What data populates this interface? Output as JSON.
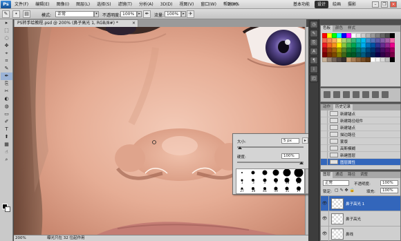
{
  "app": {
    "logo": "Ps"
  },
  "menu": [
    "文件(F)",
    "编辑(E)",
    "图像(I)",
    "图层(L)",
    "选择(S)",
    "滤镜(T)",
    "分析(A)",
    "3D(D)",
    "视图(V)",
    "窗口(W)",
    "帮助(H)"
  ],
  "menubar_right": {
    "zoom": "200%",
    "workspace_label": "基本功能",
    "workspace_design": "设计",
    "workspace_paint": "绘画",
    "workspace_photo": "摄影"
  },
  "options": {
    "mode_label": "模式:",
    "mode_value": "正常",
    "opacity_label": "不透明度:",
    "opacity_value": "100%",
    "flow_label": "流量:",
    "flow_value": "100%"
  },
  "tools": [
    "▸",
    "⬚",
    "◌",
    "✥",
    "⌖",
    "⌗",
    "✎",
    "✒",
    "⎘",
    "✂",
    "◐",
    "◍",
    "▭",
    "✐",
    "T",
    "⬆",
    "▦",
    "☝",
    "⌕"
  ],
  "document": {
    "tab_title": "PS转手绘教程.psd @ 200% (鼻子高光 1, RGB/8#) *",
    "close_glyph": "×"
  },
  "status": {
    "zoom": "200%",
    "info": "曝光只在 32 位起作用"
  },
  "brush_picker": {
    "size_label": "大小:",
    "size_value": "5 px",
    "hardness_label": "硬度:",
    "hardness_value": "100%",
    "brushes": [
      {
        "size": 2,
        "num": ""
      },
      {
        "size": 5,
        "num": ""
      },
      {
        "size": 7,
        "num": ""
      },
      {
        "size": 9,
        "num": ""
      },
      {
        "size": 11,
        "num": ""
      },
      {
        "size": 13,
        "num": ""
      },
      {
        "size": 3,
        "num": "1"
      },
      {
        "size": 4,
        "num": "3"
      },
      {
        "size": 5,
        "num": "5"
      },
      {
        "size": 6,
        "num": "9"
      },
      {
        "size": 7,
        "num": "13"
      },
      {
        "size": 8,
        "num": "19"
      },
      {
        "size": 3,
        "num": "27"
      },
      {
        "size": 4,
        "num": "39"
      },
      {
        "size": 4,
        "num": "46"
      },
      {
        "size": 5,
        "num": "59"
      },
      {
        "size": 5,
        "num": "11"
      },
      {
        "size": 6,
        "num": "17"
      }
    ]
  },
  "swatches_panel": {
    "tabs": [
      "色板",
      "颜色",
      "样式"
    ],
    "colors": [
      "#ff0000",
      "#ffff00",
      "#00ff00",
      "#00ffff",
      "#0000ff",
      "#ff00ff",
      "#ffffff",
      "#e6e6e6",
      "#cccccc",
      "#b3b3b3",
      "#999999",
      "#808080",
      "#666666",
      "#4d4d4d",
      "#000000",
      "#f26c4f",
      "#f68e55",
      "#fbaf5c",
      "#fff467",
      "#acd372",
      "#7cc576",
      "#3bb878",
      "#1abbb4",
      "#00bff3",
      "#438ccb",
      "#5574b9",
      "#605ca8",
      "#855fa8",
      "#a763a8",
      "#f06ea9",
      "#ed1c24",
      "#f26522",
      "#f7941d",
      "#fff200",
      "#8dc73f",
      "#39b54a",
      "#00a651",
      "#00a99d",
      "#00aeef",
      "#0072bc",
      "#0054a6",
      "#2e3192",
      "#662d91",
      "#92278f",
      "#ec008c",
      "#9e0b0f",
      "#a0410d",
      "#a3620a",
      "#aba000",
      "#598527",
      "#1a7b30",
      "#007236",
      "#00746b",
      "#0076a3",
      "#004b80",
      "#003471",
      "#1b1464",
      "#440e62",
      "#630460",
      "#9e005d",
      "#790000",
      "#7b2e00",
      "#7d4900",
      "#827b00",
      "#406618",
      "#005e20",
      "#005826",
      "#005952",
      "#005b7f",
      "#003663",
      "#002157",
      "#0d004c",
      "#32004b",
      "#4b0049",
      "#7b0046",
      "#c7b299",
      "#998675",
      "#736357",
      "#534741",
      "#37302d",
      "#c69c6d",
      "#a67c52",
      "#8c6239",
      "#754c24",
      "#603913",
      "#ffffff",
      "#f2f2f2",
      "#d9d9d9",
      "#bfbfbf",
      "#000000"
    ]
  },
  "history_panel": {
    "tabs": [
      "动作",
      "历史记录"
    ],
    "items": [
      "新建锚点",
      "新建路径组件",
      "新建锚点",
      "描边路径",
      "蒙版",
      "高斯模糊",
      "新建图层",
      "图层属性"
    ],
    "selected_index": 7
  },
  "layers_panel": {
    "tabs": [
      "图层",
      "通道",
      "路径",
      "调整"
    ],
    "blend_mode": "正常",
    "opacity_label": "不透明度:",
    "opacity_value": "100%",
    "lock_label": "锁定:",
    "fill_label": "填充:",
    "fill_value": "100%",
    "layers": [
      "鼻子高光 1",
      "鼻子高光",
      "鼻线"
    ],
    "selected_index": 0
  }
}
